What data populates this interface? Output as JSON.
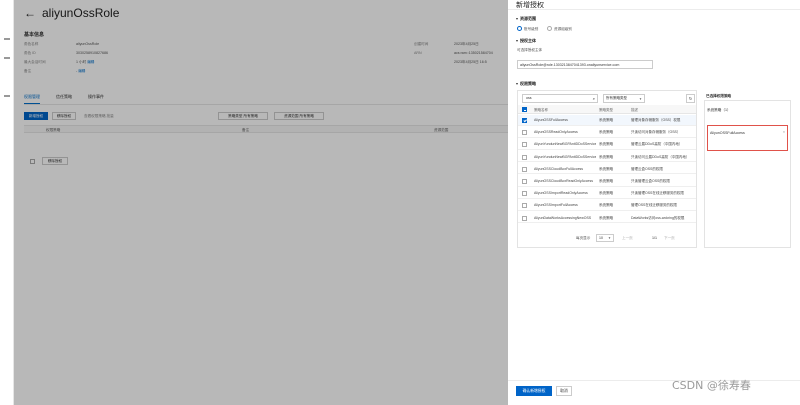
{
  "page": {
    "title": "aliyunOssRole",
    "basic_info_heading": "基本信息",
    "basic_info": {
      "left": [
        {
          "k": "角色名称",
          "v": "aliyunOssRole"
        },
        {
          "k": "角色 ID",
          "v": "3030258910827686"
        },
        {
          "k": "最大会话时间",
          "v": "1 小时",
          "link": "编辑"
        },
        {
          "k": "备注",
          "v": "-",
          "link": "编辑"
        }
      ],
      "right": [
        {
          "k": "创建时间",
          "v": "2023年4月25日"
        },
        {
          "k": "ARN",
          "v": "acs:ram::135021584704"
        },
        {
          "k": "",
          "v": "2023年4月25日 16:5"
        }
      ]
    },
    "tabs": [
      "权限管理",
      "信任策略",
      "操作事件"
    ],
    "add_permission_button": "新增授权",
    "remove_button": "移除授权",
    "filter_text": "查看权限策略    批量",
    "right_filter_a": "策略类型  所有策略",
    "right_filter_b": "资源范围  所有策略",
    "table_headers": [
      "权限策略",
      "备注",
      "资源范围"
    ],
    "bottom_remove_button": "移除授权"
  },
  "drawer": {
    "title": "新增授权",
    "section_resource": "资源范围",
    "radio_account": "账号级别",
    "radio_group": "资源组级别",
    "section_principal": "授权主体",
    "principal_label": "可选择授权主体",
    "principal_value": "aliyunOssRole@role.1303213847041393.onaliyunservice.com",
    "section_policy": "权限策略",
    "search_value": "oss",
    "policy_type_select": "所有策略类型",
    "policy_headers": [
      "策略名称",
      "策略类型",
      "描述"
    ],
    "policies": [
      {
        "name": "AliyunOSSFullAccess",
        "type": "系统策略",
        "desc": "管理对象存储服务（OSS）权限",
        "checked": true
      },
      {
        "name": "AliyunOSSReadOnlyAccess",
        "type": "系统策略",
        "desc": "只读访问对象存储服务（OSS）",
        "checked": false
      },
      {
        "name": "AliyunYundunNewBGPAntiDDoSServiceFullAccess",
        "type": "系统策略",
        "desc": "管理云盾DDoS高防（中国内地）",
        "checked": false
      },
      {
        "name": "AliyunYundunNewBGPAntiDDoSServiceReadOnlyAccess",
        "type": "系统策略",
        "desc": "只读访问云盾DDoS高防（中国内地）",
        "checked": false
      },
      {
        "name": "AliyunOSSCloudBoxFullAccess",
        "type": "系统策略",
        "desc": "管理云盒OSS的权限",
        "checked": false
      },
      {
        "name": "AliyunOSSCloudBoxReadOnlyAccess",
        "type": "系统策略",
        "desc": "只读管理云盒OSS的权限",
        "checked": false
      },
      {
        "name": "AliyunOSSImportReadOnlyAccess",
        "type": "系统策略",
        "desc": "只读管理OSS在线迁移服务的权限",
        "checked": false
      },
      {
        "name": "AliyunOSSImportFullAccess",
        "type": "系统策略",
        "desc": "管理OSS在线迁移服务的权限",
        "checked": false
      },
      {
        "name": "AliyunDataWorksAccessingNewOSS",
        "type": "系统策略",
        "desc": "DataWorks访问oss-wokring的权限",
        "checked": false
      }
    ],
    "pager_label": "每页显示",
    "pager_size": "10",
    "pager_prev": "上一页",
    "pager_current": "1/1",
    "pager_next": "下一页",
    "selected_heading": "已选择权限策略",
    "selected_group": "系统策略（1）",
    "selected_item": "AliyunOSSFullAccess",
    "confirm_button": "确认新增授权",
    "cancel_button": "取消"
  },
  "watermark": "CSDN @徐寿春",
  "colors": {
    "primary": "#0064c8",
    "highlight": "#e0524a"
  }
}
